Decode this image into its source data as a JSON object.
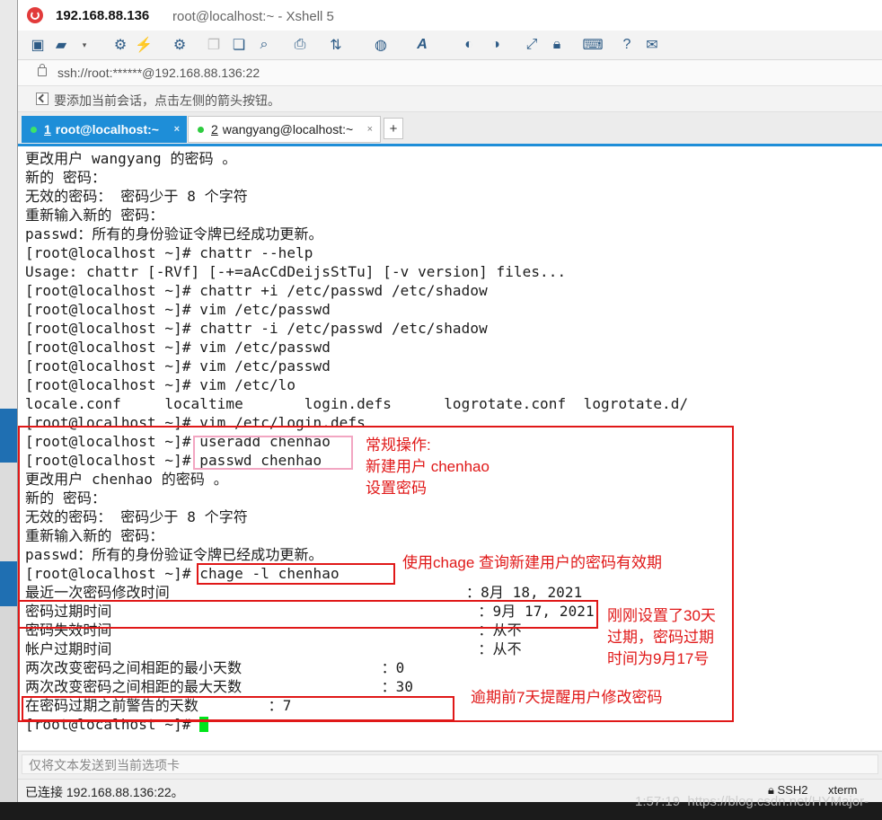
{
  "window": {
    "title_ip": "192.168.88.136",
    "title_rest": "root@localhost:~ - Xshell 5"
  },
  "toolbar": {
    "icons": [
      "new-session-icon",
      "open-folder-icon",
      "reconnect-icon",
      "disconnect-icon",
      "properties-icon",
      "copy-icon",
      "paste-icon",
      "find-icon",
      "print-icon",
      "transfer-icon",
      "globe-icon",
      "font-icon",
      "xftp-icon",
      "xagent-icon",
      "fullscreen-icon",
      "lock-icon",
      "keyboard-icon",
      "help-icon",
      "chat-icon"
    ]
  },
  "address": {
    "url": "ssh://root:******@192.168.88.136:22"
  },
  "hint": {
    "text": "要添加当前会话，点击左侧的箭头按钮。"
  },
  "tabs": [
    {
      "number": "1",
      "label": "root@localhost:~",
      "close": "×"
    },
    {
      "number": "2",
      "label": "wangyang@localhost:~",
      "close": "×"
    }
  ],
  "add_tab": "+",
  "terminal": {
    "lines": [
      "更改用户 wangyang 的密码 。",
      "新的 密码：",
      "无效的密码： 密码少于 8 个字符",
      "重新输入新的 密码：",
      "passwd：所有的身份验证令牌已经成功更新。",
      "[root@localhost ~]# chattr --help",
      "Usage: chattr [-RVf] [-+=aAcCdDeijsStTu] [-v version] files...",
      "[root@localhost ~]# chattr +i /etc/passwd /etc/shadow",
      "[root@localhost ~]# vim /etc/passwd",
      "[root@localhost ~]# chattr -i /etc/passwd /etc/shadow",
      "[root@localhost ~]# vim /etc/passwd",
      "[root@localhost ~]# vim /etc/passwd",
      "[root@localhost ~]# vim /etc/lo",
      "locale.conf     localtime       login.defs      logrotate.conf  logrotate.d/",
      "[root@localhost ~]# vim /etc/login.defs",
      "[root@localhost ~]# useradd chenhao",
      "[root@localhost ~]# passwd chenhao",
      "更改用户 chenhao 的密码 。",
      "新的 密码：",
      "无效的密码： 密码少于 8 个字符",
      "重新输入新的 密码：",
      "passwd：所有的身份验证令牌已经成功更新。",
      "[root@localhost ~]# chage -l chenhao",
      "最近一次密码修改时间                                  ：8月 18, 2021",
      "密码过期时间                                          ：9月 17, 2021",
      "密码失效时间                                          ：从不",
      "帐户过期时间                                          ：从不",
      "两次改变密码之间相距的最小天数                ：0",
      "两次改变密码之间相距的最大天数                ：30",
      "在密码过期之前警告的天数        ：7",
      "[root@localhost ~]# "
    ]
  },
  "annotations": {
    "note1": "常规操作:\n新建用户 chenhao\n设置密码",
    "note2": "使用chage 查询新建用户的密码有效期",
    "note3": "刚刚设置了30天\n过期，密码过期\n时间为9月17号",
    "note4": "逾期前7天提醒用户修改密码"
  },
  "send_bar": {
    "placeholder": "仅将文本发送到当前选项卡"
  },
  "status": {
    "connection": "已连接 192.168.88.136:22。",
    "protocol": "SSH2",
    "terminal_type": "xterm"
  },
  "watermark": "1:57:19  https://blog.csdn.net/HYMajor-",
  "colors": {
    "accent": "#1e8ed8",
    "annotation_red": "#e01818",
    "annotation_pink": "#f2a6c2",
    "cursor": "#00e51a"
  }
}
